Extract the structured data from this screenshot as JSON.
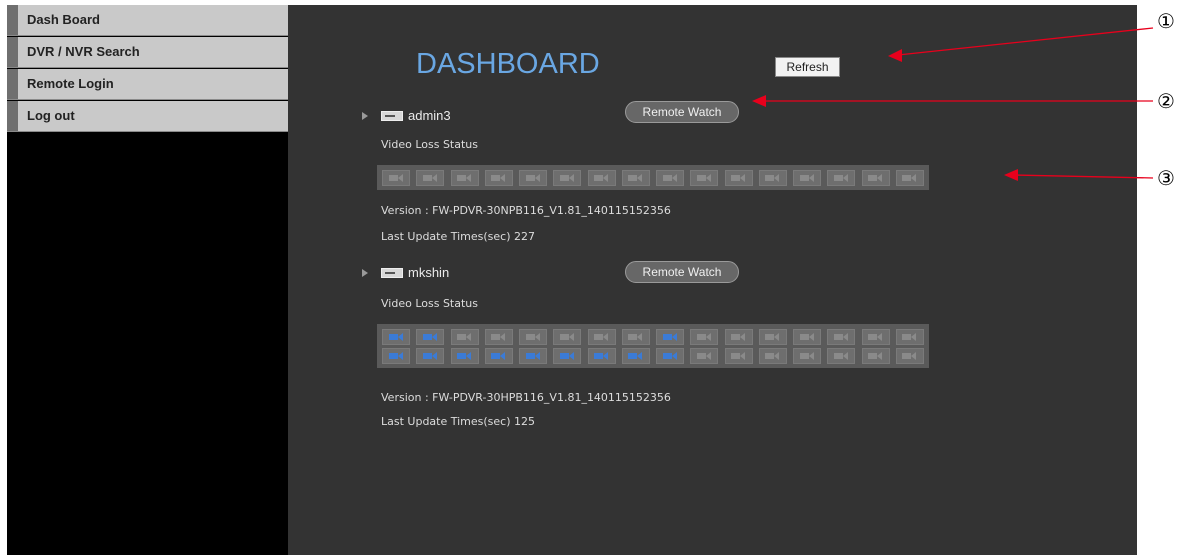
{
  "sidebar": {
    "items": [
      {
        "label": "Dash Board"
      },
      {
        "label": "DVR / NVR Search"
      },
      {
        "label": "Remote Login"
      },
      {
        "label": "Log out"
      }
    ]
  },
  "dashboard": {
    "title": "DASHBOARD",
    "refresh_label": "Refresh",
    "video_loss_label": "Video Loss Status",
    "remote_watch_label": "Remote Watch",
    "devices": [
      {
        "name": "admin3",
        "version": "Version : FW-PDVR-30NPB116_V1.81_140115152356",
        "last_update": "Last Update Times(sec) 227",
        "channels": [
          [
            0,
            0,
            0,
            0,
            0,
            0,
            0,
            0,
            0,
            0,
            0,
            0,
            0,
            0,
            0,
            0
          ]
        ]
      },
      {
        "name": "mkshin",
        "version": "Version : FW-PDVR-30HPB116_V1.81_140115152356",
        "last_update": "Last Update Times(sec) 125",
        "channels": [
          [
            1,
            1,
            0,
            0,
            0,
            0,
            0,
            0,
            1,
            0,
            0,
            0,
            0,
            0,
            0,
            0
          ],
          [
            1,
            1,
            1,
            1,
            1,
            1,
            1,
            1,
            1,
            0,
            0,
            0,
            0,
            0,
            0,
            0
          ]
        ]
      }
    ]
  },
  "annotations": {
    "labels": [
      "①",
      "②",
      "③"
    ],
    "arrow_color": "#e8001c"
  },
  "colors": {
    "title": "#6aa7e3",
    "panel_bg": "#333333",
    "camera_active": "#3b7bd6"
  }
}
